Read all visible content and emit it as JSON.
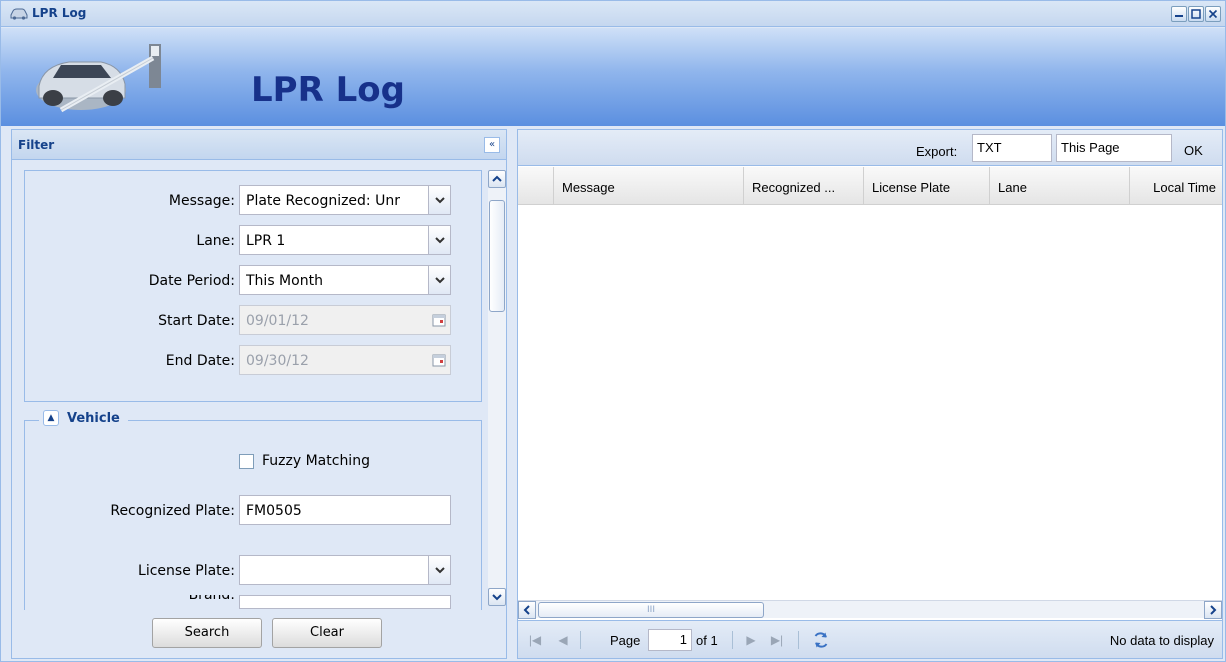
{
  "window": {
    "title": "LPR Log",
    "icon": "car-icon"
  },
  "banner": {
    "title": "LPR Log",
    "logo": "car-barrier-logo"
  },
  "filter": {
    "header": "Filter",
    "collapse_icon": "double-chevron-left-icon",
    "fields": {
      "message": {
        "label": "Message:",
        "value": "Plate Recognized: Unr"
      },
      "lane": {
        "label": "Lane:",
        "value": "LPR 1"
      },
      "date_period": {
        "label": "Date Period:",
        "value": "This Month"
      },
      "start_date": {
        "label": "Start Date:",
        "value": "09/01/12"
      },
      "end_date": {
        "label": "End Date:",
        "value": "09/30/12"
      }
    },
    "vehicle": {
      "legend": "Vehicle",
      "fuzzy_label": "Fuzzy Matching",
      "fuzzy_checked": false,
      "recognized_plate": {
        "label": "Recognized Plate:",
        "value": "FM0505"
      },
      "license_plate": {
        "label": "License Plate:",
        "value": ""
      },
      "brand": {
        "label": "Brand:",
        "value": ""
      }
    },
    "buttons": {
      "search": "Search",
      "clear": "Clear"
    }
  },
  "grid": {
    "toolbar": {
      "export_label": "Export:",
      "format": "TXT",
      "scope": "This Page",
      "ok": "OK"
    },
    "columns": [
      "Message",
      "Recognized ...",
      "License Plate",
      "Lane",
      "Local Time"
    ],
    "rows": [],
    "pager": {
      "page_label": "Page",
      "page": "1",
      "of_label": "of 1",
      "status": "No data to display"
    }
  }
}
